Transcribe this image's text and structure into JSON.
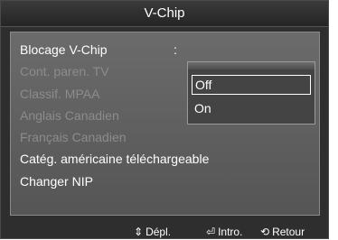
{
  "title": "V-Chip",
  "menu": {
    "items": [
      {
        "label": "Blocage V-Chip",
        "enabled": true
      },
      {
        "label": "Cont. paren. TV",
        "enabled": false
      },
      {
        "label": "Classif. MPAA",
        "enabled": false
      },
      {
        "label": "Anglais Canadien",
        "enabled": false
      },
      {
        "label": "Français Canadien",
        "enabled": false
      },
      {
        "label": "Catég. américaine téléchargeable",
        "enabled": true
      },
      {
        "label": "Changer NIP",
        "enabled": true
      }
    ],
    "separator": ":"
  },
  "dropdown": {
    "options": [
      "Off",
      "On"
    ],
    "selected": "Off"
  },
  "footer": {
    "move": {
      "icon": "up-down-arrow-icon",
      "glyph": "⇕",
      "label": "Dépl."
    },
    "enter": {
      "icon": "enter-icon",
      "glyph": "⏎",
      "label": "Intro."
    },
    "back": {
      "icon": "return-icon",
      "glyph": "⟲",
      "label": "Retour"
    }
  }
}
